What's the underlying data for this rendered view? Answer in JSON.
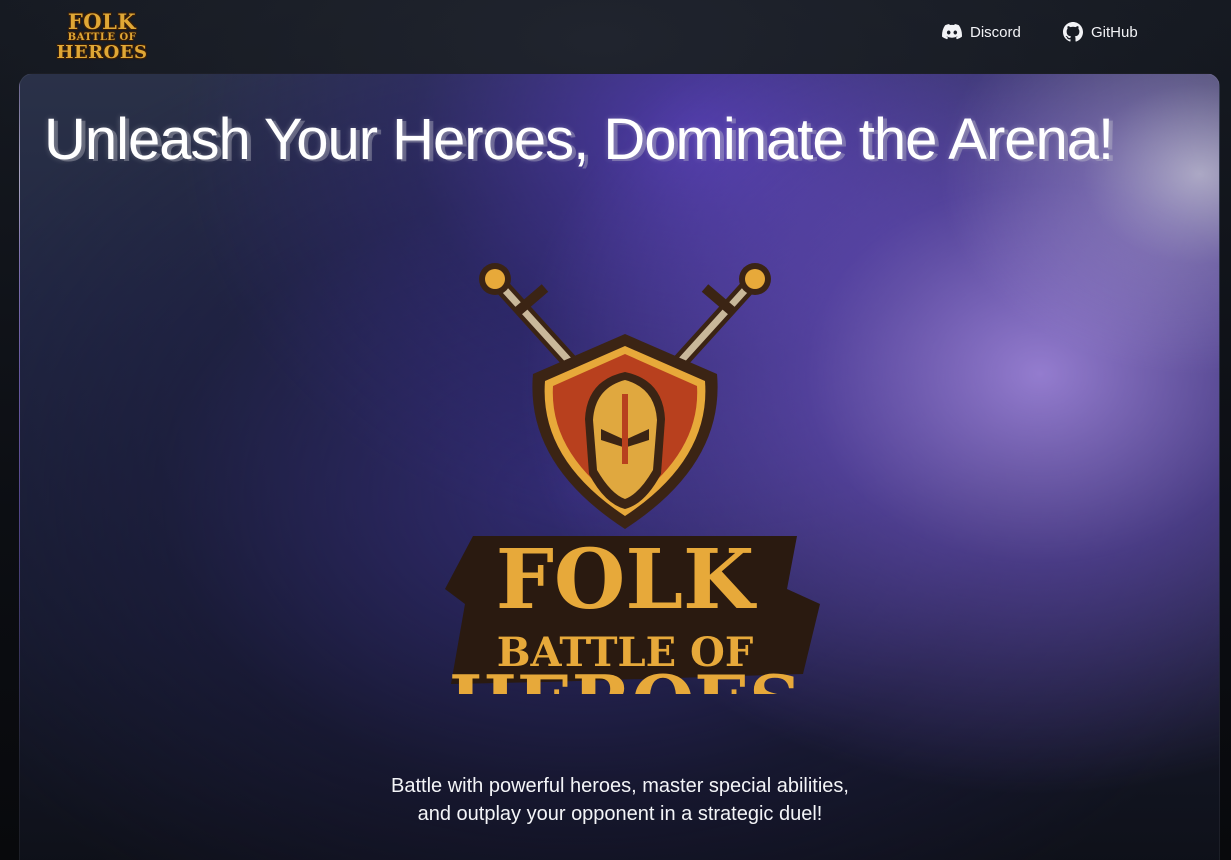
{
  "header": {
    "brand": {
      "line1": "FOLK",
      "line2": "BATTLE OF",
      "line3": "HEROES"
    },
    "nav": [
      {
        "label": "Discord",
        "icon": "discord-icon"
      },
      {
        "label": "GitHub",
        "icon": "github-icon"
      }
    ]
  },
  "hero": {
    "title": "Unleash Your Heroes, Dominate the Arena!",
    "logo": {
      "line1": "FOLK",
      "line2": "BATTLE OF",
      "line3": "HEROES"
    },
    "tagline": {
      "line1": "Battle with powerful heroes, master special abilities,",
      "line2": "and outplay your opponent in a strategic duel!"
    }
  },
  "colors": {
    "accent_gold": "#e7a93a",
    "shield_red": "#b8401e",
    "hero_purple": "#6a4fd0",
    "text": "#ffffff"
  }
}
